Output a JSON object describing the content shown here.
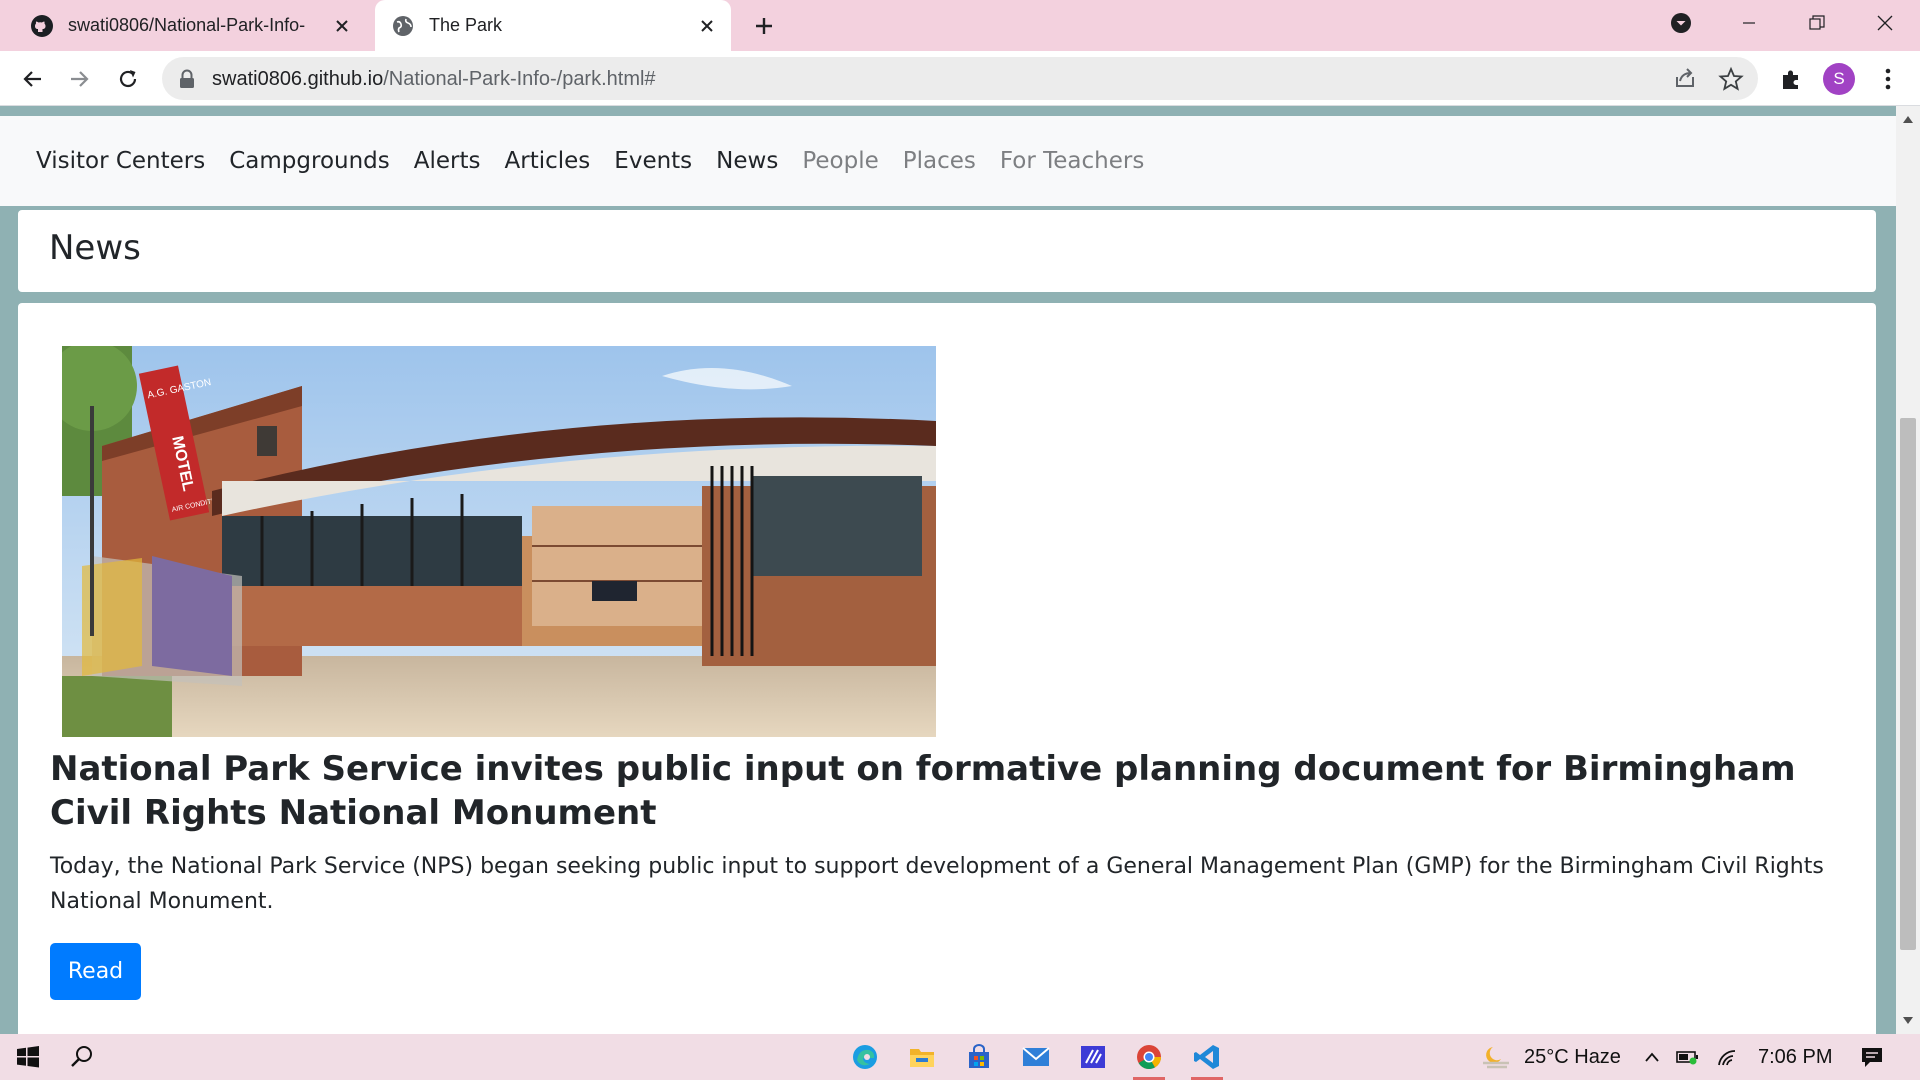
{
  "browser": {
    "tabs": [
      {
        "title": "swati0806/National-Park-Info-",
        "icon": "github-icon",
        "active": false
      },
      {
        "title": "The Park",
        "icon": "globe-icon",
        "active": true
      }
    ],
    "url_host": "swati0806.github.io",
    "url_path": "/National-Park-Info-/park.html#",
    "profile_initial": "S",
    "colors": {
      "tabstrip": "#f3d1de",
      "profile": "#a142c4"
    }
  },
  "page": {
    "nav": [
      {
        "label": "Visitor Centers",
        "muted": false
      },
      {
        "label": "Campgrounds",
        "muted": false
      },
      {
        "label": "Alerts",
        "muted": false
      },
      {
        "label": "Articles",
        "muted": false
      },
      {
        "label": "Events",
        "muted": false
      },
      {
        "label": "News",
        "muted": false
      },
      {
        "label": "People",
        "muted": true
      },
      {
        "label": "Places",
        "muted": true
      },
      {
        "label": "For Teachers",
        "muted": true
      }
    ],
    "section_title": "News",
    "article": {
      "title": "National Park Service invites public input on formative planning document for Birmingham Civil Rights National Monument",
      "body": "Today, the National Park Service (NPS) began seeking public input to support development of a General Management Plan (GMP) for the Birmingham Civil Rights National Monument.",
      "button_label": "Read",
      "image_sign": {
        "line1": "A.G. GASTON",
        "line2": "MOTEL",
        "line3": "AIR CONDITIONED"
      }
    },
    "colors": {
      "background": "#8fb1b3",
      "button": "#007bff"
    }
  },
  "taskbar": {
    "weather": "25°C  Haze",
    "time": "7:06 PM",
    "apps": [
      "edge-icon",
      "file-explorer-icon",
      "store-icon",
      "mail-icon",
      "powerapps-icon",
      "chrome-icon",
      "vscode-icon"
    ]
  }
}
